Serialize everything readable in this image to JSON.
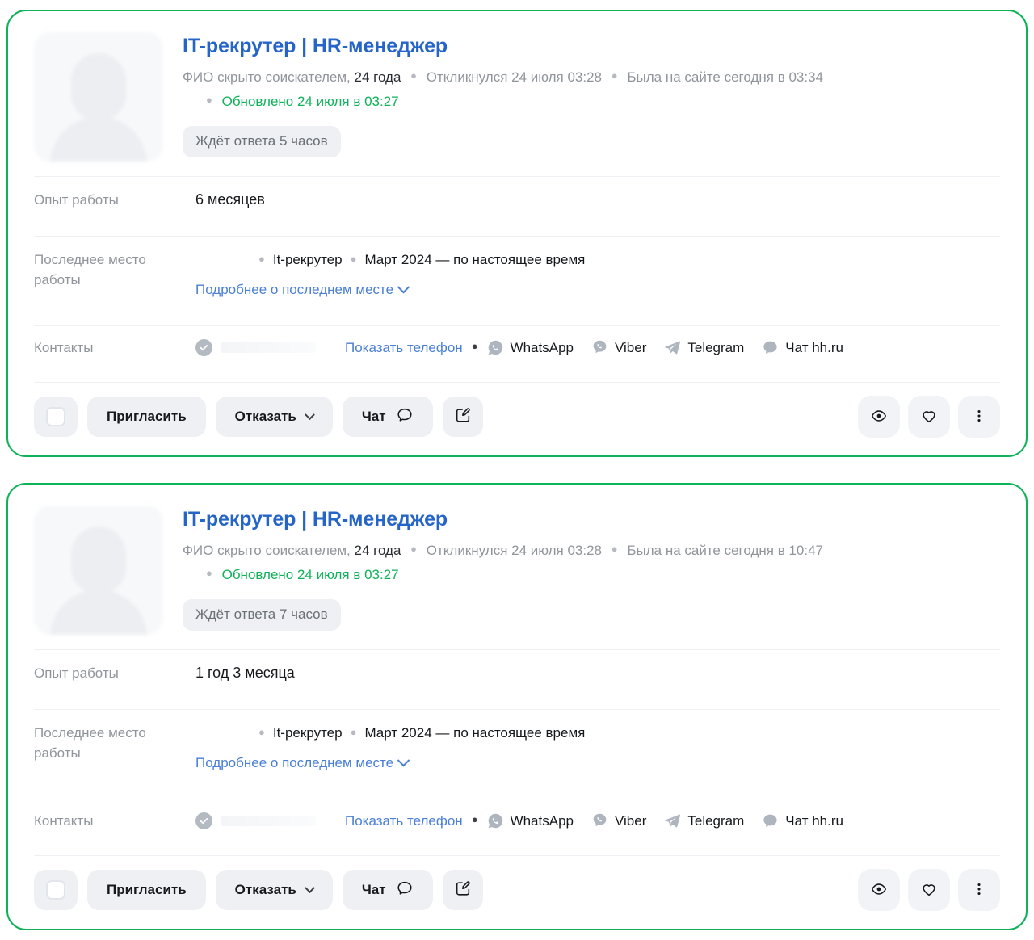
{
  "colors": {
    "card_border_green": "#0fb259",
    "title_blue": "#2665c8",
    "link_blue": "#4a7fd6",
    "updated_green": "#0fb259",
    "muted_gray": "#90959c",
    "button_bg": "#eef0f4"
  },
  "cards": [
    {
      "avatar_alt": "avatar-placeholder",
      "title": "IT-рекрутер | HR-менеджер",
      "name_hidden": "ФИО скрыто соискателем,",
      "age": "24 года",
      "applied": "Откликнулся 24 июля 03:28",
      "last_visit": "Была на сайте сегодня в 03:34",
      "updated": "Обновлено 24 июля в 03:27",
      "wait_badge": "Ждёт ответа 5 часов",
      "experience_label": "Опыт работы",
      "experience_value": "6 месяцев",
      "last_job_label": "Последнее место работы",
      "last_job_position": "It-рекрутер",
      "last_job_period": "Март 2024 — по настоящее время",
      "more_link": "Подробнее о последнем месте",
      "contacts_label": "Контакты",
      "show_phone": "Показать телефон",
      "messengers": [
        {
          "name": "WhatsApp",
          "icon": "whatsapp-icon"
        },
        {
          "name": "Viber",
          "icon": "viber-icon"
        },
        {
          "name": "Telegram",
          "icon": "telegram-icon"
        },
        {
          "name": "Чат hh.ru",
          "icon": "hh-chat-icon"
        }
      ],
      "actions": {
        "invite": "Пригласить",
        "reject": "Отказать",
        "chat": "Чат",
        "edit_icon": "edit-note-icon",
        "view_icon": "eye-icon",
        "favorite_icon": "heart-icon",
        "more_icon": "kebab-menu-icon",
        "checkbox_icon": "selection-checkbox"
      }
    },
    {
      "avatar_alt": "avatar-placeholder",
      "title": "IT-рекрутер | HR-менеджер",
      "name_hidden": "ФИО скрыто соискателем,",
      "age": "24 года",
      "applied": "Откликнулся 24 июля 03:28",
      "last_visit": "Была на сайте сегодня в 10:47",
      "updated": "Обновлено 24 июля в 03:27",
      "wait_badge": "Ждёт ответа 7 часов",
      "experience_label": "Опыт работы",
      "experience_value": "1 год 3 месяца",
      "last_job_label": "Последнее место работы",
      "last_job_position": "It-рекрутер",
      "last_job_period": "Март 2024 — по настоящее время",
      "more_link": "Подробнее о последнем месте",
      "contacts_label": "Контакты",
      "show_phone": "Показать телефон",
      "messengers": [
        {
          "name": "WhatsApp",
          "icon": "whatsapp-icon"
        },
        {
          "name": "Viber",
          "icon": "viber-icon"
        },
        {
          "name": "Telegram",
          "icon": "telegram-icon"
        },
        {
          "name": "Чат hh.ru",
          "icon": "hh-chat-icon"
        }
      ],
      "actions": {
        "invite": "Пригласить",
        "reject": "Отказать",
        "chat": "Чат",
        "edit_icon": "edit-note-icon",
        "view_icon": "eye-icon",
        "favorite_icon": "heart-icon",
        "more_icon": "kebab-menu-icon",
        "checkbox_icon": "selection-checkbox"
      }
    }
  ]
}
